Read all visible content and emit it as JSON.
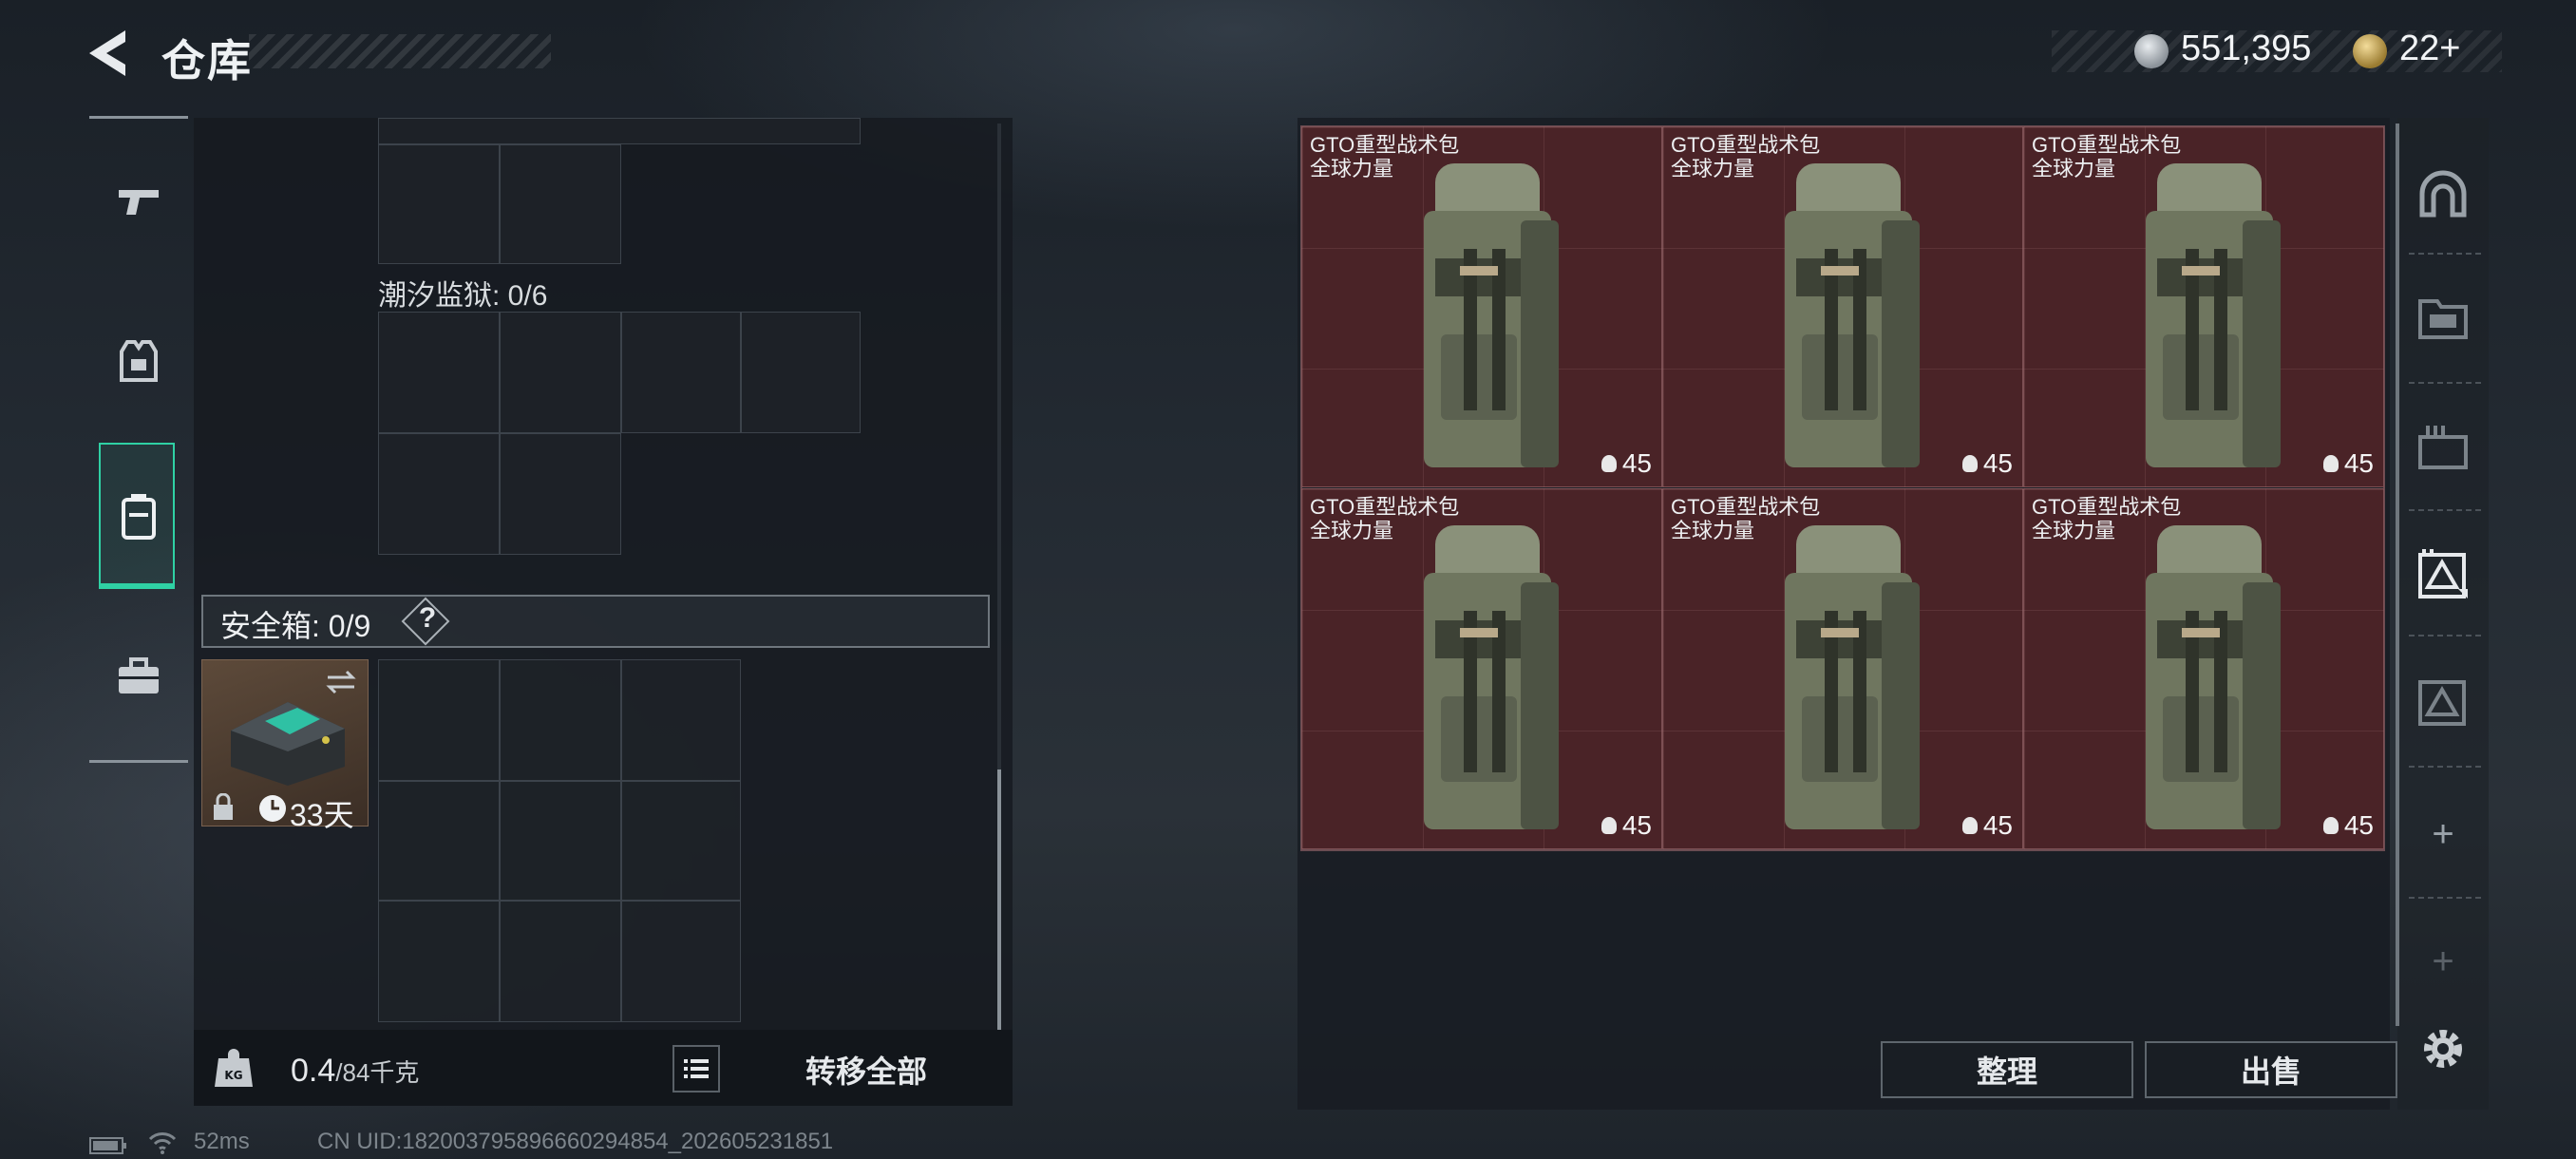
{
  "header": {
    "title": "仓库"
  },
  "currency": {
    "silver": "551,395",
    "gold": "22+"
  },
  "left_rail": {
    "items": [
      {
        "name": "weapons",
        "icon": "pistol-icon"
      },
      {
        "name": "armor",
        "icon": "vest-icon"
      },
      {
        "name": "backpack",
        "icon": "backpack-icon",
        "active": true
      },
      {
        "name": "toolbox",
        "icon": "briefcase-icon"
      }
    ]
  },
  "inventory": {
    "container_label": "潮汐监狱: 0/6",
    "safe_box_label": "安全箱: 0/9",
    "help": "?",
    "safe_item": {
      "duration": "33天"
    }
  },
  "footer": {
    "weight_value": "0.4",
    "weight_max": "/84千克",
    "transfer_all": "转移全部"
  },
  "stash": {
    "items": [
      {
        "name": "GTO重型战术包\n全球力量",
        "count": "45"
      },
      {
        "name": "GTO重型战术包\n全球力量",
        "count": "45"
      },
      {
        "name": "GTO重型战术包\n全球力量",
        "count": "45"
      },
      {
        "name": "GTO重型战术包\n全球力量",
        "count": "45"
      },
      {
        "name": "GTO重型战术包\n全球力量",
        "count": "45"
      },
      {
        "name": "GTO重型战术包\n全球力量",
        "count": "45"
      }
    ],
    "sort_label": "整理",
    "sell_label": "出售"
  },
  "status_bar": {
    "ping": "52ms",
    "uid": "CN UID:182003795896660294854_202605231851"
  }
}
